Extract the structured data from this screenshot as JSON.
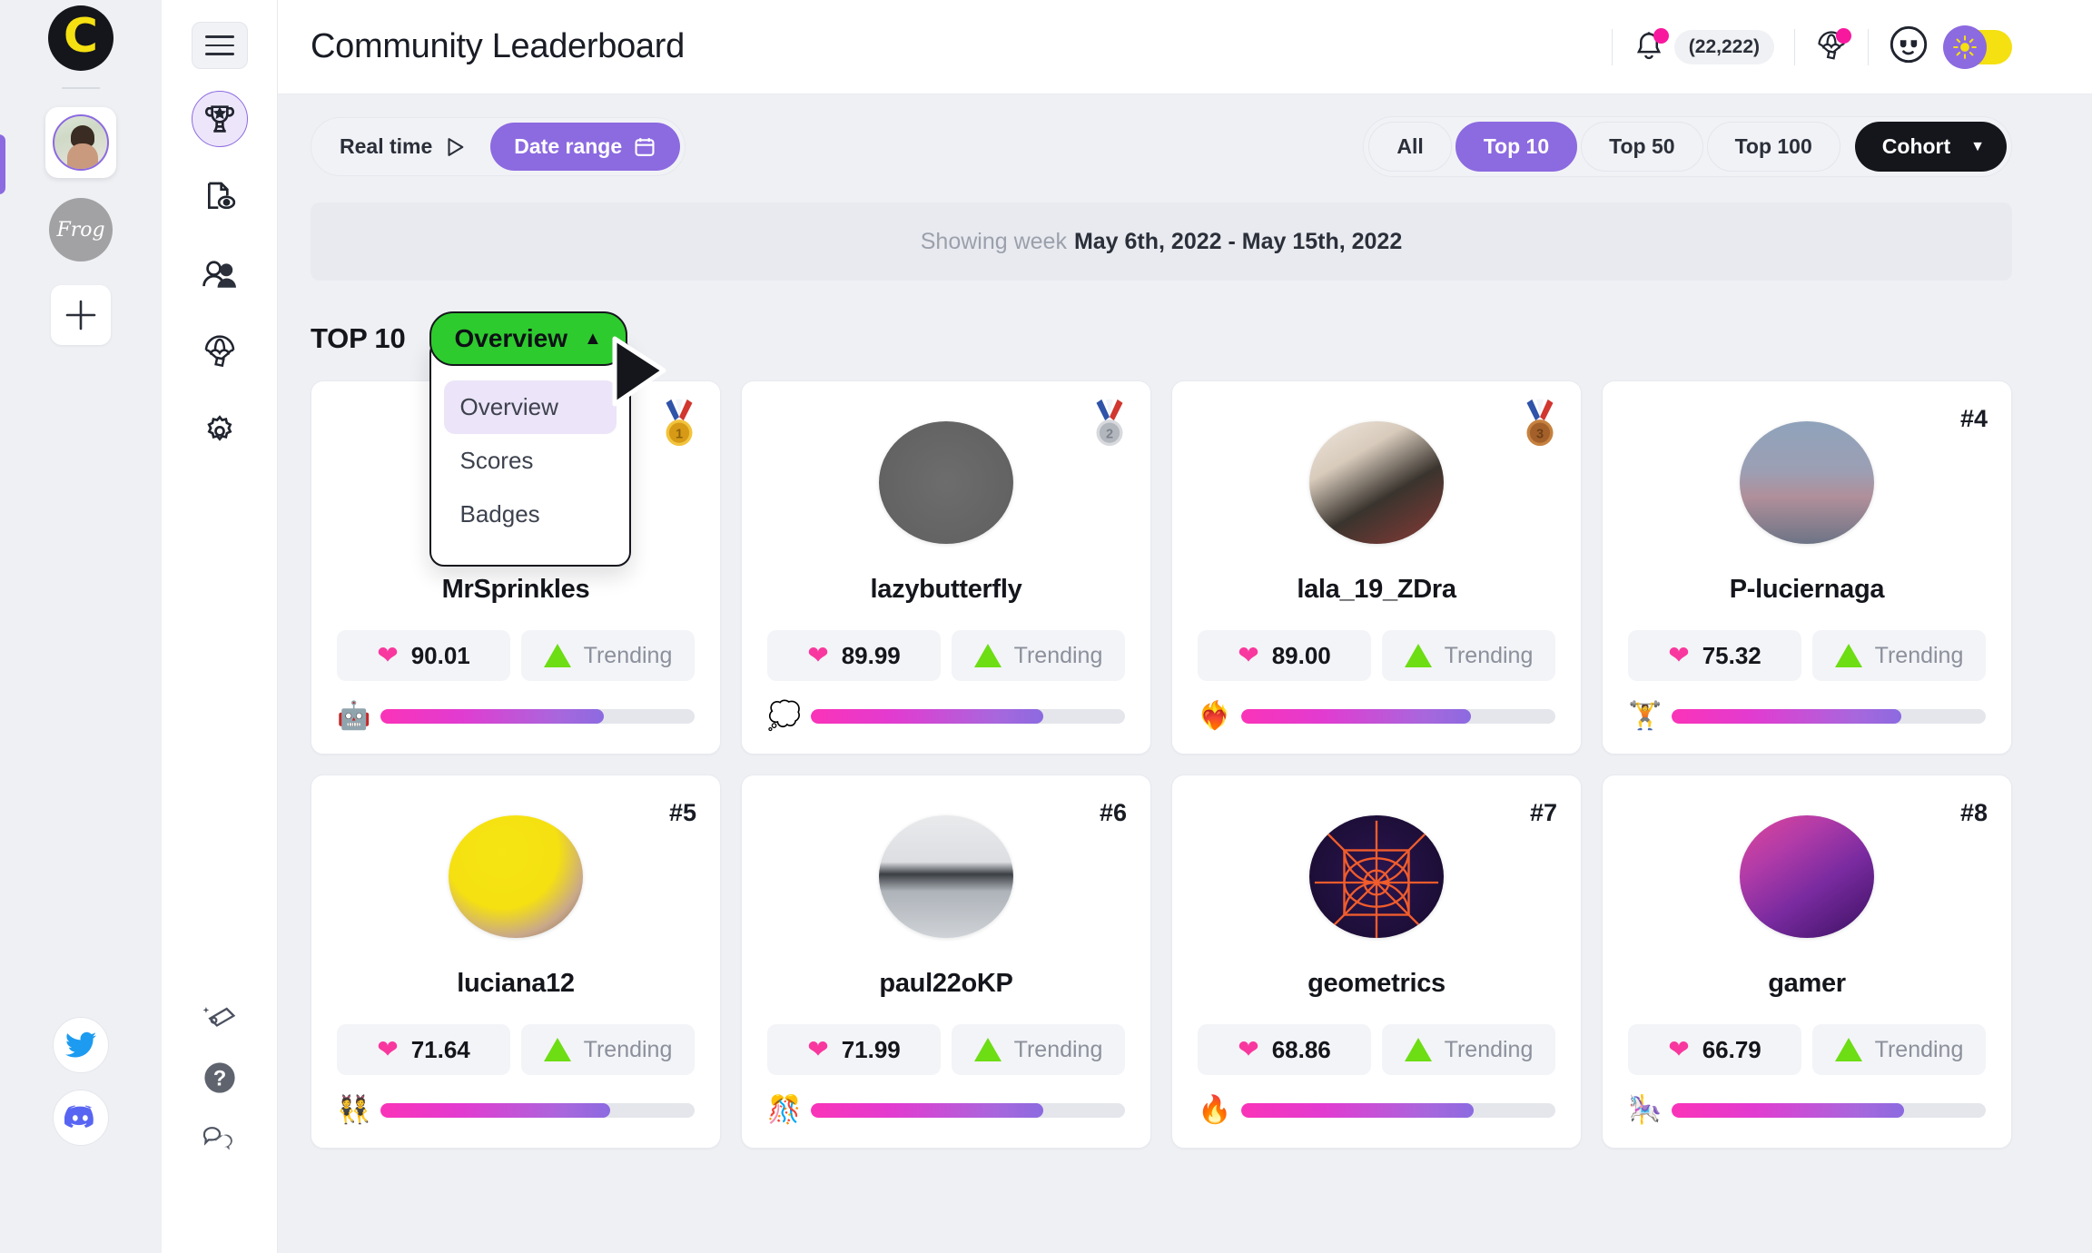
{
  "rail": {
    "logo_letter": "C",
    "workspaces": [
      {
        "name": "personal-workspace",
        "label": ""
      },
      {
        "name": "frog-workspace",
        "label": "Frog"
      }
    ],
    "add_label": "+",
    "social": [
      {
        "name": "twitter-icon",
        "label": "Twitter"
      },
      {
        "name": "discord-icon",
        "label": "Discord"
      }
    ]
  },
  "iconnav": {
    "items": [
      {
        "name": "trophy-icon",
        "label": "Leaderboard",
        "active": true
      },
      {
        "name": "document-eye-icon",
        "label": "Reports",
        "active": false
      },
      {
        "name": "people-icon",
        "label": "Members",
        "active": false
      },
      {
        "name": "parachute-icon",
        "label": "Airdrops",
        "active": false
      },
      {
        "name": "gear-icon",
        "label": "Settings",
        "active": false
      }
    ],
    "bottom": [
      {
        "name": "megaphone-icon",
        "label": "Announcements"
      },
      {
        "name": "question-icon",
        "label": "Help"
      },
      {
        "name": "chat-icon",
        "label": "Chat"
      }
    ]
  },
  "header": {
    "title": "Community Leaderboard",
    "notification_count": "(22,222)",
    "icons": [
      {
        "name": "bell-icon",
        "badge": true
      },
      {
        "name": "parachute-icon",
        "badge": true
      },
      {
        "name": "sunglasses-face-icon",
        "badge": false
      }
    ],
    "theme_toggle": {
      "name": "theme-toggle",
      "state": "light",
      "knob_icon": "sun-icon"
    }
  },
  "controls": {
    "mode_segment": [
      {
        "label": "Real time",
        "icon": "play-icon",
        "active": false
      },
      {
        "label": "Date range",
        "icon": "calendar-icon",
        "active": true
      }
    ],
    "scope_pills": [
      {
        "label": "All",
        "active": false
      },
      {
        "label": "Top 10",
        "active": true
      },
      {
        "label": "Top 50",
        "active": false
      },
      {
        "label": "Top 100",
        "active": false
      }
    ],
    "cohort": {
      "label": "Cohort",
      "caret": "▼"
    }
  },
  "week_banner": {
    "prefix": "Showing week",
    "range": "May 6th, 2022 - May 15th, 2022"
  },
  "section": {
    "title": "TOP 10",
    "dropdown": {
      "selected": "Overview",
      "caret": "▲",
      "open": true,
      "options": [
        {
          "label": "Overview",
          "selected": true
        },
        {
          "label": "Scores",
          "selected": false
        },
        {
          "label": "Badges",
          "selected": false
        }
      ]
    }
  },
  "leaderboard": {
    "trending_label": "Trending",
    "cards": [
      {
        "rank": 1,
        "rank_display": "",
        "medal": "gold",
        "username": "MrSprinkles",
        "score": "90.01",
        "trend": "Trending",
        "progress": 71,
        "emoji": "🤖",
        "avatar_style": "photo-grey"
      },
      {
        "rank": 2,
        "rank_display": "",
        "medal": "silver",
        "username": "lazybutterfly",
        "score": "89.99",
        "trend": "Trending",
        "progress": 74,
        "emoji": "💭",
        "avatar_style": "nes-controller"
      },
      {
        "rank": 3,
        "rank_display": "",
        "medal": "bronze",
        "username": "lala_19_ZDra",
        "score": "89.00",
        "trend": "Trending",
        "progress": 73,
        "emoji": "❤️‍🔥",
        "avatar_style": "photo-bandana"
      },
      {
        "rank": 4,
        "rank_display": "#4",
        "medal": "",
        "username": "P-luciernaga",
        "score": "75.32",
        "trend": "Trending",
        "progress": 73,
        "emoji": "🏋️",
        "avatar_style": "photo-dusk"
      },
      {
        "rank": 5,
        "rank_display": "#5",
        "medal": "",
        "username": "luciana12",
        "score": "71.64",
        "trend": "Trending",
        "progress": 73,
        "emoji": "👯",
        "avatar_style": "photo-yellow"
      },
      {
        "rank": 6,
        "rank_display": "#6",
        "medal": "",
        "username": "paul22oKP",
        "score": "71.99",
        "trend": "Trending",
        "progress": 74,
        "emoji": "🎊",
        "avatar_style": "photo-lake"
      },
      {
        "rank": 7,
        "rank_display": "#7",
        "medal": "",
        "username": "geometrics",
        "score": "68.86",
        "trend": "Trending",
        "progress": 74,
        "emoji": "🔥",
        "avatar_style": "geometric-art"
      },
      {
        "rank": 8,
        "rank_display": "#8",
        "medal": "",
        "username": "gamer",
        "score": "66.79",
        "trend": "Trending",
        "progress": 74,
        "emoji": "🎠",
        "avatar_style": "photo-purple"
      }
    ]
  },
  "colors": {
    "accent_purple": "#8c6ae0",
    "accent_green": "#2ecb2e",
    "accent_pink": "#f8389e",
    "accent_yellow": "#f5e011",
    "ink": "#14161c",
    "page_bg": "#eef0f4"
  }
}
